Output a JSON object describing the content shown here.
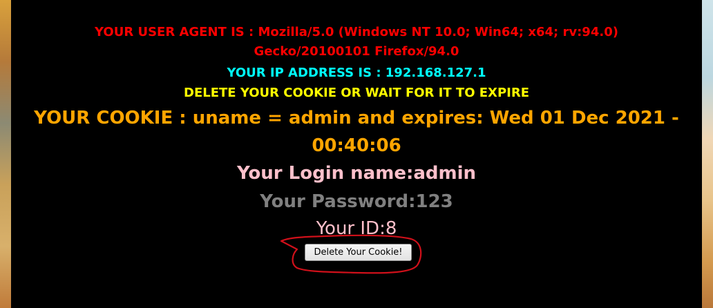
{
  "user_agent": {
    "line1": "YOUR USER AGENT IS : Mozilla/5.0 (Windows NT 10.0; Win64; x64; rv:94.0)",
    "line2": "Gecko/20100101 Firefox/94.0"
  },
  "ip_address": "YOUR IP ADDRESS IS : 192.168.127.1",
  "delete_notice": "DELETE YOUR COOKIE OR WAIT FOR IT TO EXPIRE",
  "cookie": {
    "line1": "YOUR COOKIE : uname = admin and expires: Wed 01 Dec 2021 -",
    "line2": "00:40:06"
  },
  "login_name": "Your Login name:admin",
  "password": "Your Password:123",
  "user_id": "Your ID:8",
  "delete_button_label": "Delete Your Cookie!",
  "colors": {
    "user_agent": "#ff0000",
    "ip_address": "#00ffff",
    "delete_notice": "#ffff00",
    "cookie": "#ffa500",
    "login_name": "#ffc0cb",
    "password": "#808080",
    "annotation_circle": "#d0101a"
  }
}
